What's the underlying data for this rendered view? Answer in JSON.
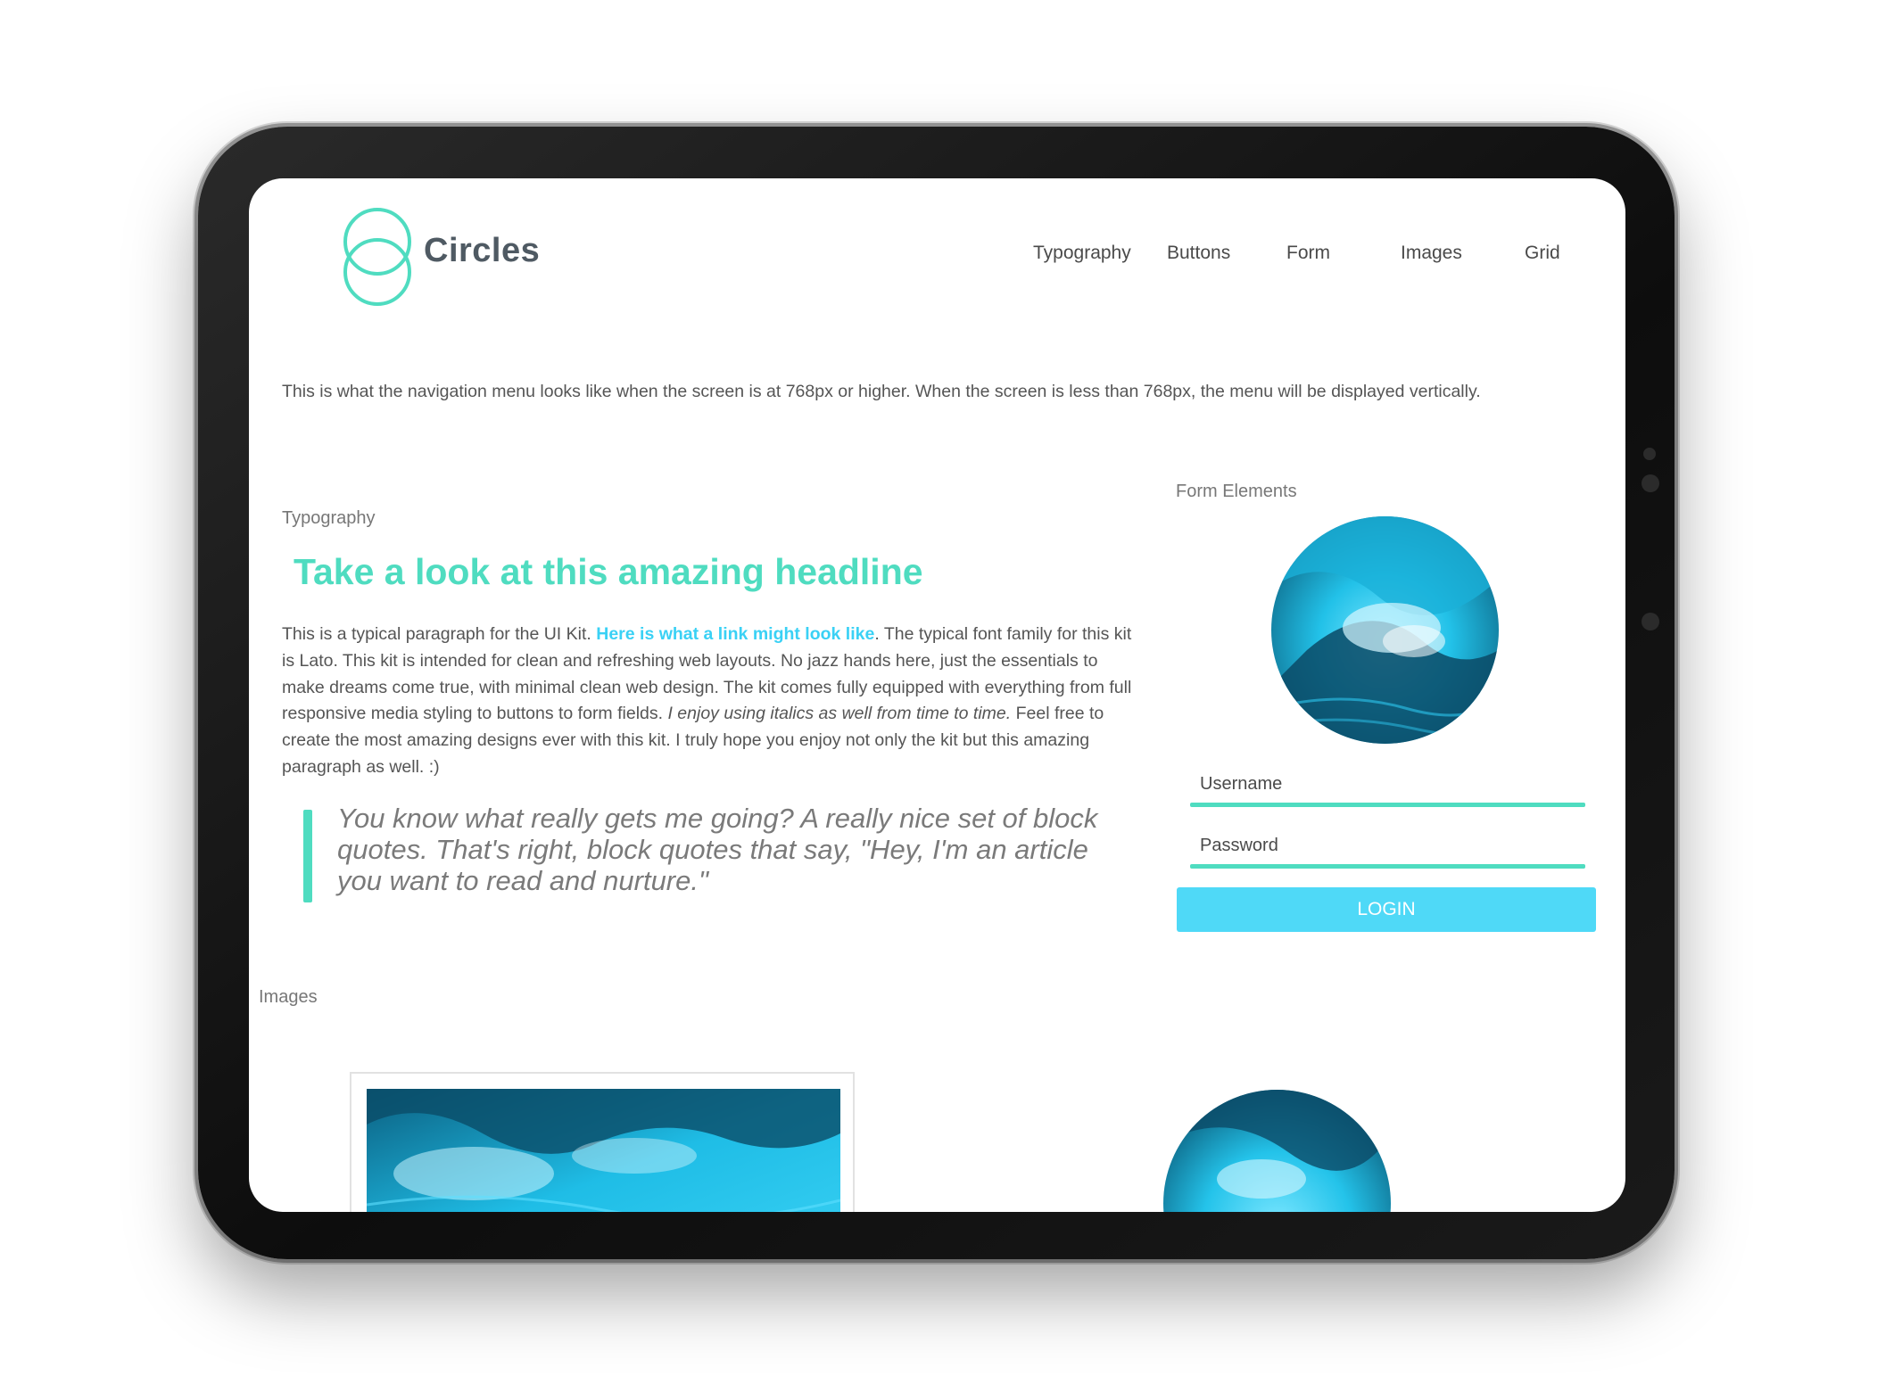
{
  "brand": {
    "name": "Circles",
    "accent": "#4fdcc0",
    "link_color": "#3ad1f5",
    "button_color": "#4fd9f7"
  },
  "nav": {
    "items": [
      "Typography",
      "Buttons",
      "Form",
      "Images",
      "Grid"
    ]
  },
  "intro_text": "This is what the navigation menu looks like when the screen is at 768px or higher. When the screen is less than 768px, the menu will be displayed vertically.",
  "typography": {
    "label": "Typography",
    "headline": "Take a look at this amazing headline",
    "para_start": "This is a typical paragraph for the UI Kit. ",
    "link_text": "Here is what a link might look like",
    "para_mid": ". The typical font family for this kit is Lato. This kit is intended for clean and refreshing web layouts. No jazz hands here, just the essentials to make dreams come true, with minimal clean web design. The kit comes fully equipped with everything from full responsive media styling to buttons to form fields. ",
    "para_italic": "I enjoy using italics as well from time to time.",
    "para_end": " Feel free to create the most amazing designs ever with this kit. I truly hope you enjoy not only the kit but this amazing paragraph as well. :)",
    "blockquote": "You know what really gets me going? A really nice set of block quotes. That's right, block quotes that say, \"Hey, I'm an article you want to read and nurture.\""
  },
  "form": {
    "label": "Form Elements",
    "username_placeholder": "Username",
    "password_placeholder": "Password",
    "login_label": "LOGIN"
  },
  "images": {
    "label": "Images"
  }
}
